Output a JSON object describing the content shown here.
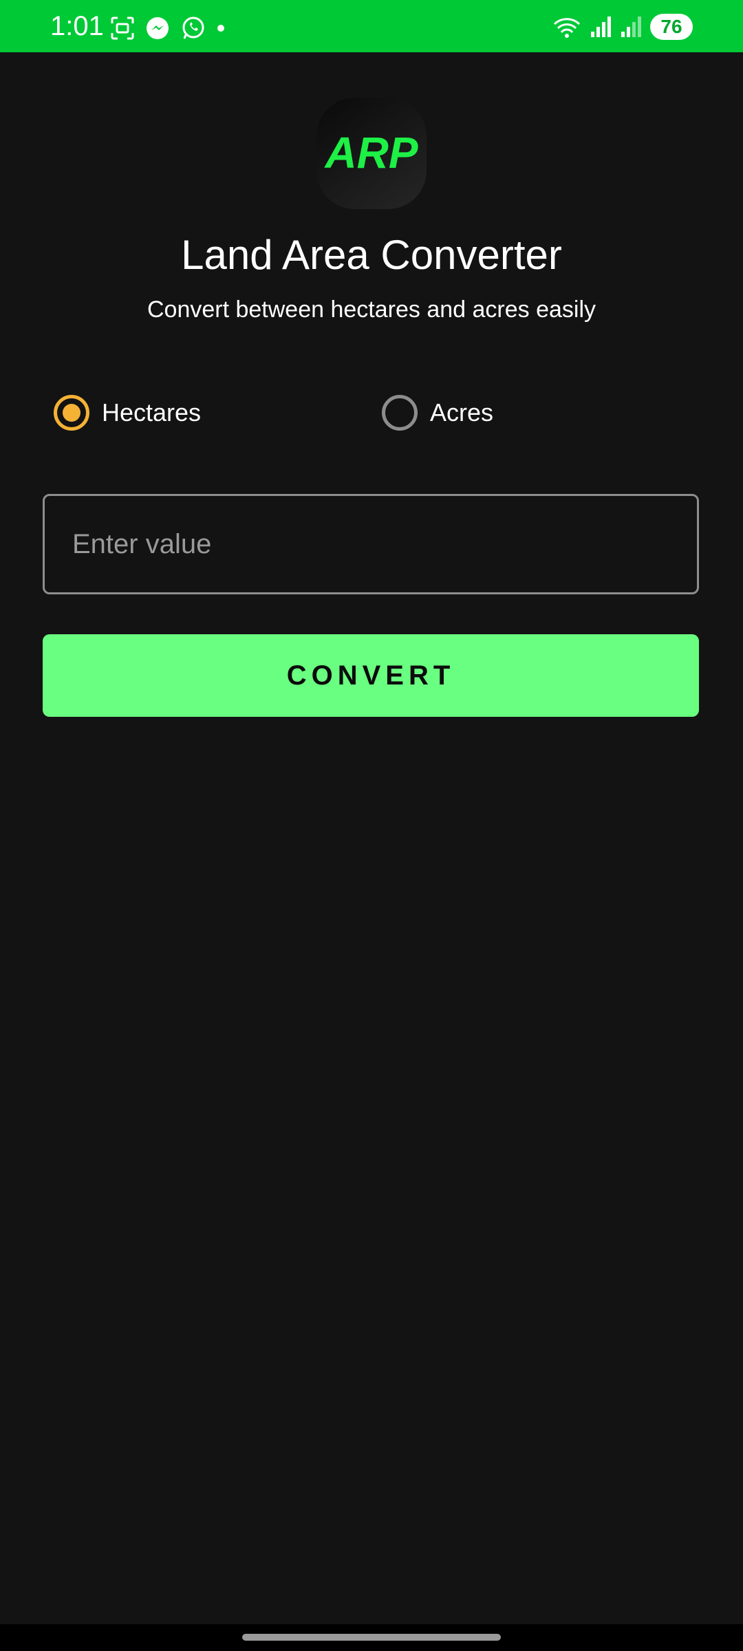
{
  "status_bar": {
    "time": "1:01",
    "battery": "76",
    "left_icons": [
      "screenshot-icon",
      "messenger-icon",
      "whatsapp-icon",
      "notification-dot-icon"
    ],
    "right_icons": [
      "wifi-icon",
      "signal-icon",
      "signal-icon"
    ],
    "background_color": "#00c936"
  },
  "app": {
    "logo_text": "ARP",
    "title": "Land Area Converter",
    "subtitle": "Convert between hectares and acres easily"
  },
  "unit_options": {
    "selected": "Hectares",
    "options": [
      "Hectares",
      "Acres"
    ]
  },
  "value_input": {
    "value": "",
    "placeholder": "Enter value"
  },
  "convert_button": {
    "label": "CONVERT",
    "color": "#69ff80"
  },
  "colors": {
    "background": "#131313",
    "radio_selected": "#f5b235",
    "logo_text": "#1ef046"
  }
}
